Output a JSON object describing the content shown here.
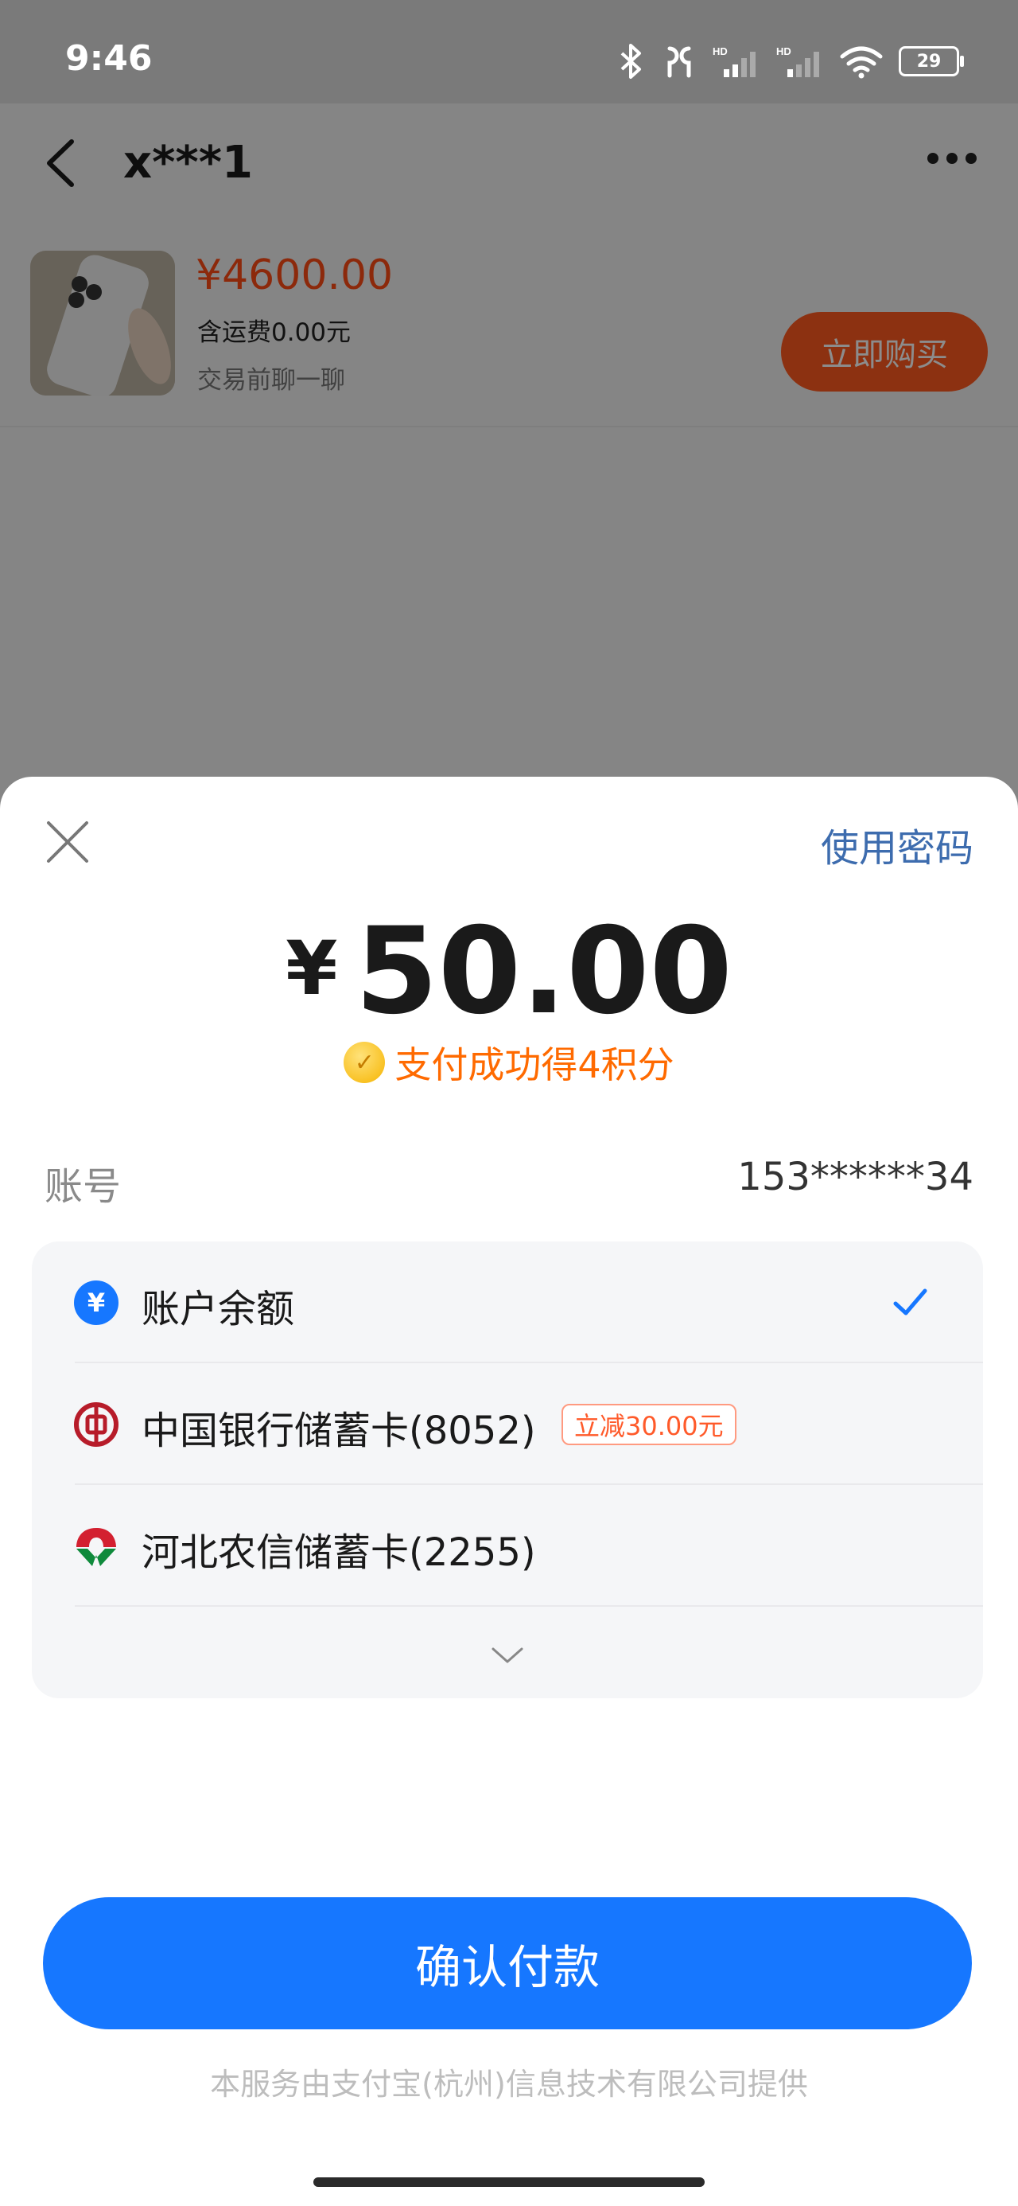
{
  "status_bar": {
    "time": "9:46",
    "battery": "29"
  },
  "header": {
    "title": "x***1"
  },
  "product": {
    "price": "¥4600.00",
    "shipping": "含运费0.00元",
    "chat_hint": "交易前聊一聊",
    "buy_button": "立即购买"
  },
  "payment": {
    "use_password": "使用密码",
    "currency": "¥",
    "amount": "50.00",
    "points_text": "支付成功得4积分",
    "account_label": "账号",
    "account_value": "153******34",
    "methods": [
      {
        "label": "账户余额",
        "selected": true
      },
      {
        "label": "中国银行储蓄卡(8052)",
        "badge": "立减30.00元"
      },
      {
        "label": "河北农信储蓄卡(2255)"
      }
    ],
    "confirm_button": "确认付款",
    "provider_note": "本服务由支付宝(杭州)信息技术有限公司提供"
  },
  "colors": {
    "primary_blue": "#1677ff",
    "price_orange": "#ff4b14",
    "link_blue": "#3d6cae",
    "points_orange": "#ff6a00"
  }
}
